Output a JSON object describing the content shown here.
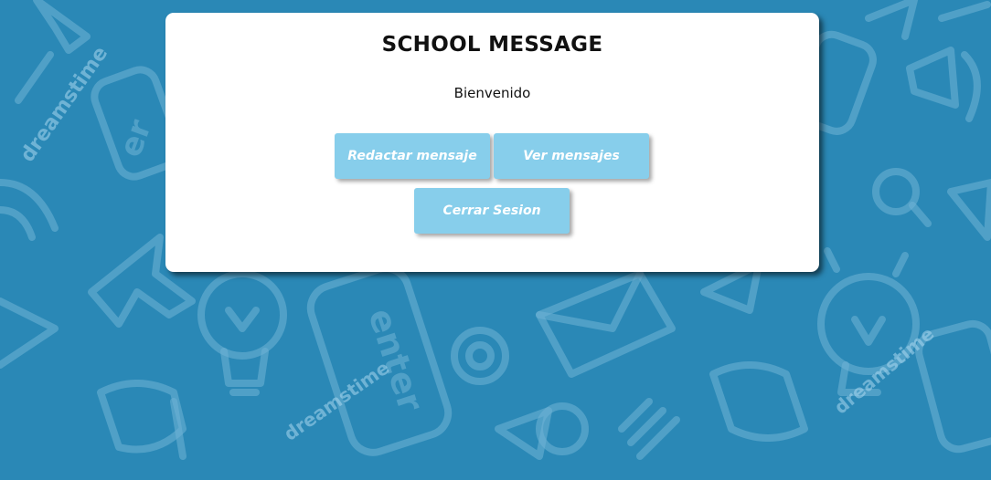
{
  "header": {
    "title": "SCHOOL MESSAGE",
    "welcome": "Bienvenido"
  },
  "actions": {
    "compose_label": "Redactar mensaje",
    "view_label": "Ver mensajes",
    "logout_label": "Cerrar Sesion"
  },
  "background": {
    "watermark": "dreamstime",
    "doodle_icons": [
      "pushpin-icon",
      "enter-key-icon",
      "wifi-icon",
      "cursor-arrow-icon",
      "lightbulb-icon",
      "at-sign-icon",
      "envelope-icon",
      "pointing-hand-icon",
      "megaphone-icon",
      "magnifier-icon"
    ]
  },
  "colors": {
    "background": "#2a88b6",
    "doodle": "#a9d7ef",
    "card": "#ffffff",
    "button": "#87ceeb",
    "button_text": "#ffffff"
  }
}
